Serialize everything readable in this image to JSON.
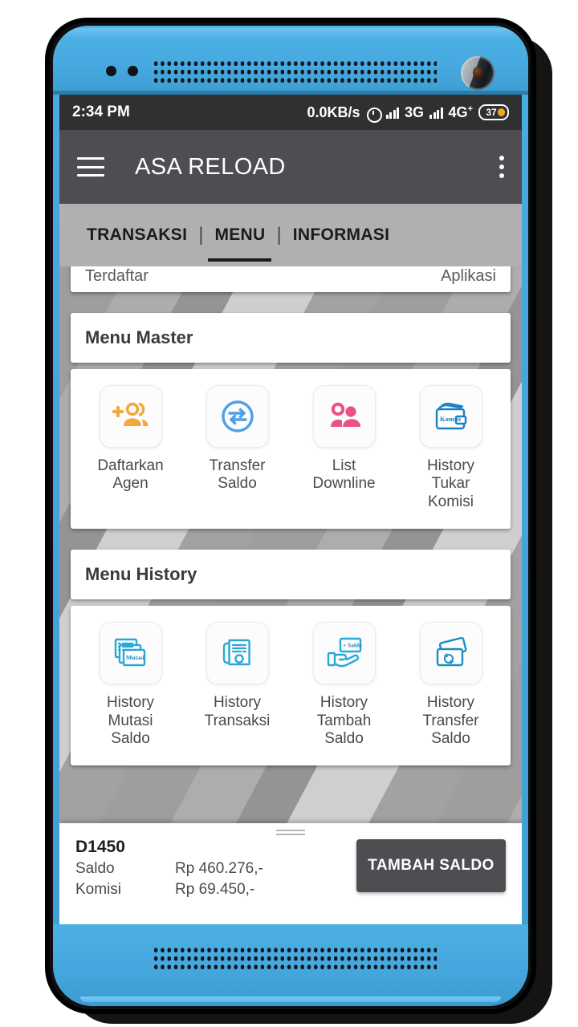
{
  "status_bar": {
    "time": "2:34 PM",
    "net_speed": "0.0KB/s",
    "alarm_icon": "alarm-icon",
    "sim1_label": "3G",
    "sim2_label": "4G",
    "sim2_sup": "+",
    "battery_level": "37"
  },
  "app_bar": {
    "menu_icon": "hamburger-icon",
    "title": "ASA RELOAD",
    "overflow_icon": "overflow-menu-icon"
  },
  "tabs": [
    {
      "label": "TRANSAKSI",
      "active": false
    },
    {
      "label": "MENU",
      "active": true
    },
    {
      "label": "INFORMASI",
      "active": false
    }
  ],
  "clipped_card": {
    "left_text": "Terdaftar",
    "right_text": "Aplikasi"
  },
  "sections": [
    {
      "title": "Menu Master",
      "items": [
        {
          "label": "Daftarkan\nAgen",
          "icon": "add-person-icon",
          "color": "#f0a93c"
        },
        {
          "label": "Transfer\nSaldo",
          "icon": "transfer-arrows-circle-icon",
          "color": "#4f9fe8"
        },
        {
          "label": "List\nDownline",
          "icon": "two-people-icon",
          "color": "#ea5287"
        },
        {
          "label": "History\nTukar\nKomisi",
          "icon": "wallet-komisi-icon",
          "color": "#1b7fc4"
        }
      ]
    },
    {
      "title": "Menu History",
      "items": [
        {
          "label": "History\nMutasi\nSaldo",
          "icon": "documents-mutasi-icon",
          "color": "#29a8d8"
        },
        {
          "label": "History\nTransaksi",
          "icon": "receipt-printer-icon",
          "color": "#29a8d8"
        },
        {
          "label": "History\nTambah\nSaldo",
          "icon": "hand-card-saldo-icon",
          "color": "#29a8d8"
        },
        {
          "label": "History\nTransfer\nSaldo",
          "icon": "credit-cards-icon",
          "color": "#1b8fc0"
        }
      ]
    }
  ],
  "bottom_bar": {
    "account_id": "D1450",
    "saldo_label": "Saldo",
    "saldo_value": "Rp 460.276,-",
    "komisi_label": "Komisi",
    "komisi_value": "Rp 69.450,-",
    "button_label": "TAMBAH SALDO",
    "drag_handle_icon": "drag-handle-icon"
  },
  "wallet_icon_text": "Komisi",
  "mutasi_icon_text": "Mutasi",
  "saldo_card_icon_text": "+ Saldo",
  "theme": {
    "phone_bezel": "#47a9df",
    "app_bar": "#4e4e52",
    "tab_bar": "#b0b0b0",
    "status_bar": "#2f3032",
    "battery_accent": "#f4a81d"
  }
}
